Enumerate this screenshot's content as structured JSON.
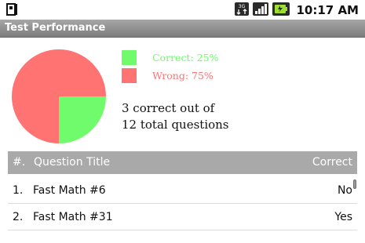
{
  "status_bar": {
    "time": "10:17 AM",
    "icons": [
      "notification-icon",
      "data-3g-icon",
      "signal-icon",
      "battery-charging-icon"
    ]
  },
  "app": {
    "title": "Test Performance"
  },
  "legend": {
    "correct_label": "Correct: 25%",
    "wrong_label": "Wrong: 75%",
    "correct_color": "#6ffb6b",
    "wrong_color": "#ff7373"
  },
  "summary": {
    "line1": "3 correct out of",
    "line2": "12 total questions"
  },
  "chart_data": {
    "type": "pie",
    "categories": [
      "Correct",
      "Wrong"
    ],
    "values": [
      25,
      75
    ],
    "colors": [
      "#6ffb6b",
      "#ff7373"
    ]
  },
  "table": {
    "headers": {
      "num": "#.",
      "title": "Question Title",
      "correct": "Correct"
    },
    "rows": [
      {
        "num": "1.",
        "title": "Fast Math #6",
        "correct": "No"
      },
      {
        "num": "2.",
        "title": "Fast Math #31",
        "correct": "Yes"
      }
    ]
  }
}
